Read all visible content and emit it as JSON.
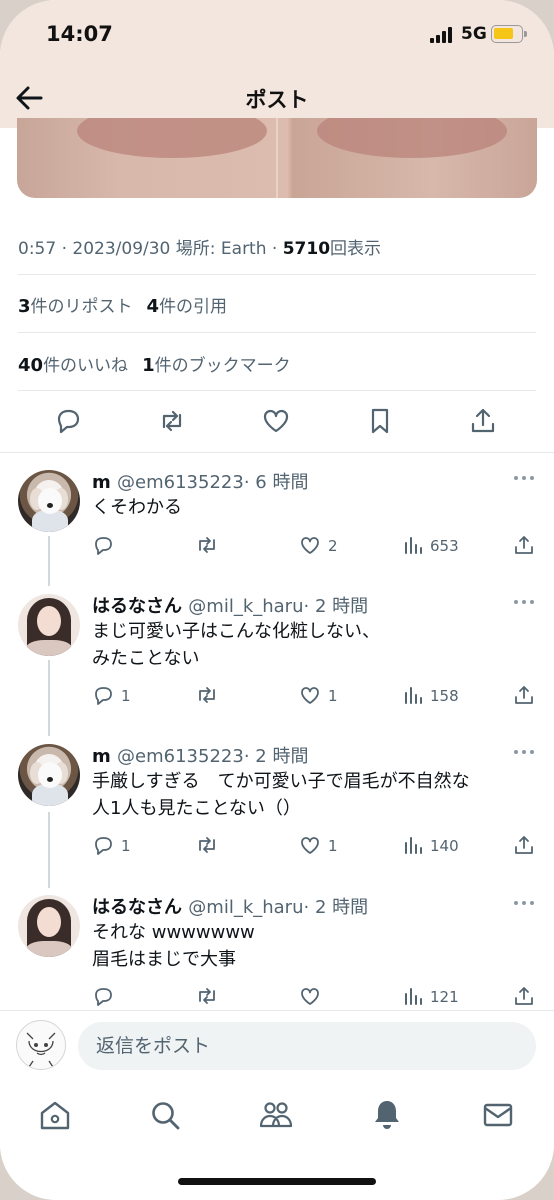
{
  "status_bar": {
    "time": "14:07",
    "network": "5G"
  },
  "header": {
    "title": "ポスト"
  },
  "post": {
    "meta_prefix": "0:57 · 2023/09/30 場所: Earth · ",
    "views_count": "5710",
    "views_label": "回表示",
    "reposts_count": "3",
    "reposts_label": "件のリポスト",
    "quotes_count": "4",
    "quotes_label": "件の引用",
    "likes_count": "40",
    "likes_label": "件のいいね",
    "bookmarks_count": "1",
    "bookmarks_label": "件のブックマーク"
  },
  "replies": [
    {
      "name": "m",
      "handle": "@em6135223",
      "time": "· 6 時間",
      "lines": [
        "くそわかる"
      ],
      "reply_count": "",
      "likes": "2",
      "views": "653"
    },
    {
      "name": "はるなさん",
      "handle": "@mil_k_haru",
      "time": "· 2 時間",
      "lines": [
        "まじ可愛い子はこんな化粧しない、",
        "みたことない"
      ],
      "reply_count": "1",
      "likes": "1",
      "views": "158"
    },
    {
      "name": "m",
      "handle": "@em6135223",
      "time": "· 2 時間",
      "lines": [
        "手厳しすぎる　てか可愛い子で眉毛が不自然な",
        "人1人も見たことない（）"
      ],
      "reply_count": "1",
      "likes": "1",
      "views": "140"
    },
    {
      "name": "はるなさん",
      "handle": "@mil_k_haru",
      "time": "· 2 時間",
      "lines": [
        "それな wwwwwww",
        "眉毛はまじで大事"
      ],
      "reply_count": "",
      "likes": "",
      "views": "121"
    }
  ],
  "composer": {
    "placeholder": "返信をポスト"
  },
  "icons": {
    "back": "arrow-left-icon",
    "reply": "speech-bubble-icon",
    "repost": "repost-icon",
    "like": "heart-icon",
    "bookmark": "bookmark-icon",
    "share": "share-icon",
    "views": "bar-chart-icon",
    "home": "home-icon",
    "search": "search-icon",
    "communities": "people-icon",
    "notifications": "bell-icon",
    "messages": "mail-icon"
  },
  "colors": {
    "text": "#0f1419",
    "secondary": "#536471",
    "topbar": "#f3e6de",
    "battery": "#f5c518"
  }
}
